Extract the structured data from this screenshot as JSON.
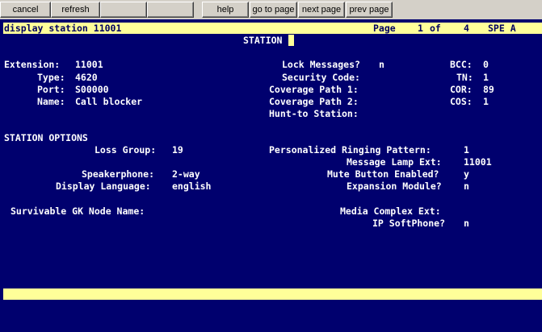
{
  "toolbar": {
    "cancel": "cancel",
    "refresh": "refresh",
    "help": "help",
    "goto_page": "go to page",
    "next_page": "next page",
    "prev_page": "prev page"
  },
  "title_bar": {
    "command": "display station 11001",
    "page_label": "Page",
    "page_current": "1",
    "page_of": "of",
    "page_total": "4",
    "spe": "SPE A"
  },
  "form_title": "STATION",
  "fields": {
    "extension_label": "Extension:",
    "extension_value": "11001",
    "type_label": "Type:",
    "type_value": "4620",
    "port_label": "Port:",
    "port_value": "S00000",
    "name_label": "Name:",
    "name_value": "Call blocker",
    "lock_messages_label": "Lock Messages?",
    "lock_messages_value": "n",
    "security_code_label": "Security Code:",
    "security_code_value": "",
    "coverage_path1_label": "Coverage Path 1:",
    "coverage_path1_value": "",
    "coverage_path2_label": "Coverage Path 2:",
    "coverage_path2_value": "",
    "hunt_to_station_label": "Hunt-to Station:",
    "hunt_to_station_value": "",
    "bcc_label": "BCC:",
    "bcc_value": "0",
    "tn_label": "TN:",
    "tn_value": "1",
    "cor_label": "COR:",
    "cor_value": "89",
    "cos_label": "COS:",
    "cos_value": "1"
  },
  "station_options": {
    "heading": "STATION OPTIONS",
    "loss_group_label": "Loss Group:",
    "loss_group_value": "19",
    "personalized_ringing_label": "Personalized Ringing Pattern:",
    "personalized_ringing_value": "1",
    "message_lamp_label": "Message Lamp Ext:",
    "message_lamp_value": "11001",
    "speakerphone_label": "Speakerphone:",
    "speakerphone_value": "2-way",
    "mute_button_label": "Mute Button Enabled?",
    "mute_button_value": "y",
    "display_language_label": "Display Language:",
    "display_language_value": "english",
    "expansion_module_label": "Expansion Module?",
    "expansion_module_value": "n",
    "survivable_gk_label": "Survivable GK Node Name:",
    "survivable_gk_value": "",
    "media_complex_label": "Media Complex Ext:",
    "media_complex_value": "",
    "ip_softphone_label": "IP SoftPhone?",
    "ip_softphone_value": "n"
  },
  "colors": {
    "screen_bg": "#00006e",
    "highlight_bar": "#ffff99",
    "text": "#ffffff",
    "toolbar_bg": "#d4d0c8"
  }
}
